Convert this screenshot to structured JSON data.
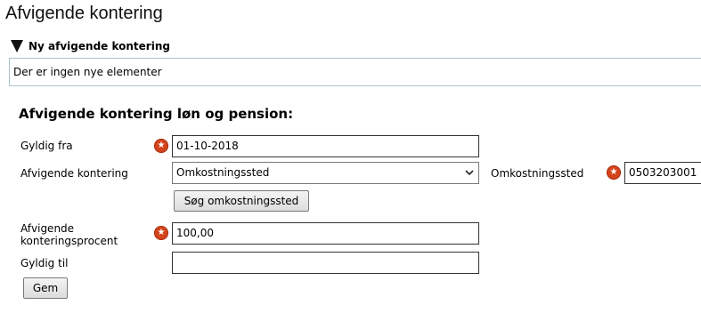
{
  "page": {
    "title": "Afvigende kontering"
  },
  "new_section": {
    "header": "Ny afvigende kontering",
    "empty_message": "Der er ingen nye elementer"
  },
  "form": {
    "title": "Afvigende kontering løn og pension:",
    "valid_from": {
      "label": "Gyldig fra",
      "value": "01-10-2018"
    },
    "deviation_type": {
      "label": "Afvigende kontering",
      "selected": "Omkostningssted"
    },
    "cost_center": {
      "label": "Omkostningssted",
      "value": "0503203001"
    },
    "search_button": "Søg omkostningssted",
    "percentage": {
      "label_line1": "Afvigende",
      "label_line2": "konteringsprocent",
      "value": "100,00"
    },
    "valid_to": {
      "label": "Gyldig til",
      "value": ""
    },
    "save_button": "Gem"
  },
  "colors": {
    "required_icon": "#d3431c",
    "info_border": "#aac4cc"
  },
  "icons": {
    "required": "required-star-icon",
    "collapse": "triangle-down-icon",
    "dropdown": "chevron-down-icon"
  }
}
